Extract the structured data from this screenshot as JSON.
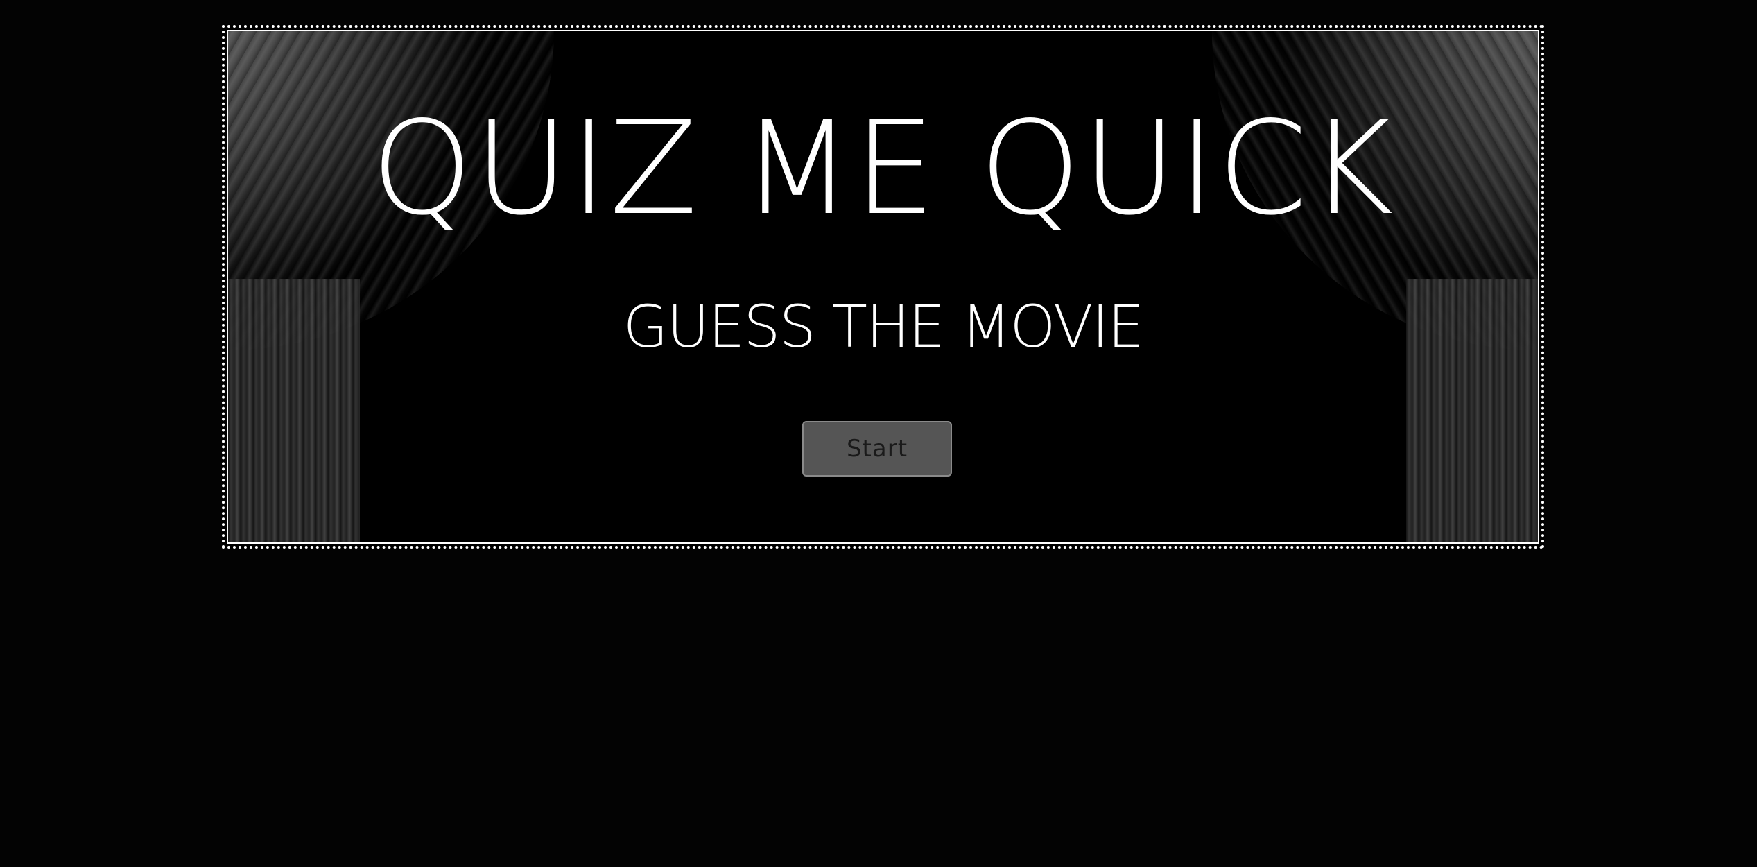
{
  "game": {
    "title": "QUIZ ME QUICK",
    "subtitle": "GUESS THE MOVIE",
    "start_label": "Start"
  },
  "colors": {
    "background": "#030303",
    "text": "#ffffff",
    "button_bg": "#555555",
    "button_text": "#1a1a1a",
    "frame": "#ffffff"
  }
}
